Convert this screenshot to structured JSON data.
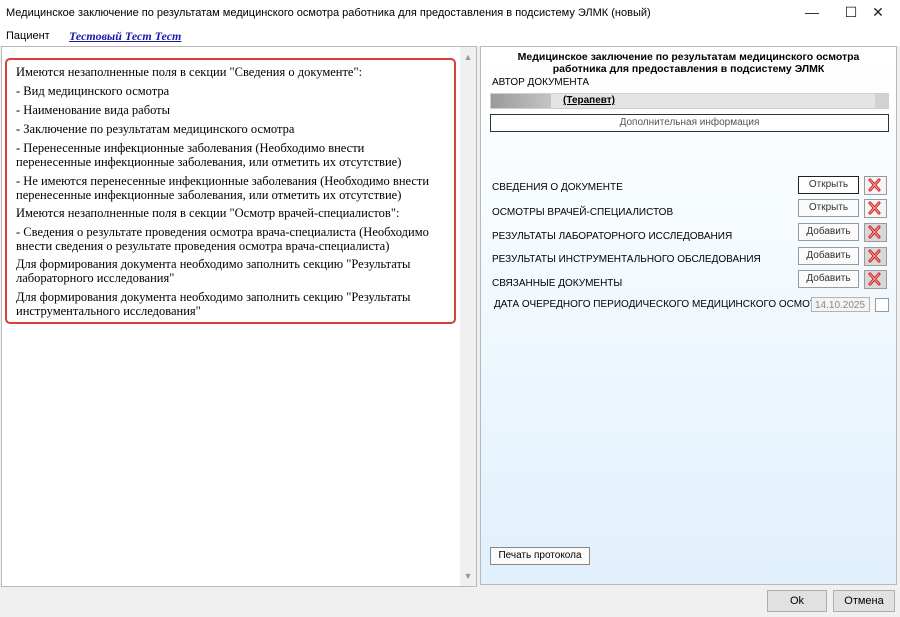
{
  "window": {
    "title": "Медицинское заключение по результатам медицинского осмотра работника для предоставления в подсистему ЭЛМК (новый)",
    "min_glyph": "—",
    "max_glyph": "☐",
    "close_glyph": "✕"
  },
  "patient": {
    "label": "Пациент",
    "name": "Тестовый Тест Тест"
  },
  "errors": {
    "lines": [
      "Имеются незаполненные поля в секции \"Сведения о документе\":",
      "- Вид медицинского осмотра",
      "- Наименование вида работы",
      "- Заключение по результатам медицинского осмотра",
      "- Перенесенные инфекционные заболевания (Необходимо внести",
      "перенесенные инфекционные заболевания, или отметить их отсутствие)",
      "- Не имеются перенесенные инфекционные заболевания (Необходимо внести",
      "перенесенные инфекционные заболевания, или отметить их отсутствие)",
      "Имеются незаполненные поля в секции \"Осмотр врачей-специалистов\":",
      "- Сведения о результате проведения осмотра врача-специалиста (Необходимо",
      "внести сведения о результате проведения осмотра врача-специалиста)",
      "Для формирования документа необходимо заполнить секцию \"Результаты",
      "лабораторного исследования\"",
      "Для формирования документа необходимо заполнить секцию \"Результаты",
      "инструментального исследования\""
    ]
  },
  "right": {
    "header_line1": "Медицинское заключение по результатам медицинского осмотра",
    "header_line2": "работника для предоставления в подсистему ЭЛМК",
    "author_label": "АВТОР ДОКУМЕНТА",
    "author_value": "(Терапевт)",
    "additional_info": "Дополнительная информация",
    "sections": [
      {
        "label": "СВЕДЕНИЯ О ДОКУМЕНТЕ",
        "button": "Открыть"
      },
      {
        "label": "ОСМОТРЫ ВРАЧЕЙ-СПЕЦИАЛИСТОВ",
        "button": "Открыть"
      },
      {
        "label": "РЕЗУЛЬТАТЫ ЛАБОРАТОРНОГО ИССЛЕДОВАНИЯ",
        "button": "Добавить"
      },
      {
        "label": "РЕЗУЛЬТАТЫ ИНСТРУМЕНТАЛЬНОГО ОБСЛЕДОВАНИЯ",
        "button": "Добавить"
      },
      {
        "label": "СВЯЗАННЫЕ ДОКУМЕНТЫ",
        "button": "Добавить"
      }
    ],
    "next_exam_label": "ДАТА ОЧЕРЕДНОГО ПЕРИОДИЧЕСКОГО МЕДИЦИНСКОГО ОСМОТРА:",
    "next_exam_date": "14.10.2025",
    "print_button": "Печать протокола"
  },
  "footer": {
    "ok": "Ok",
    "cancel": "Отмена"
  },
  "colors": {
    "error_border": "#d6403a",
    "patient_link": "#1a1aa6",
    "delete_icon": "#d02020"
  }
}
